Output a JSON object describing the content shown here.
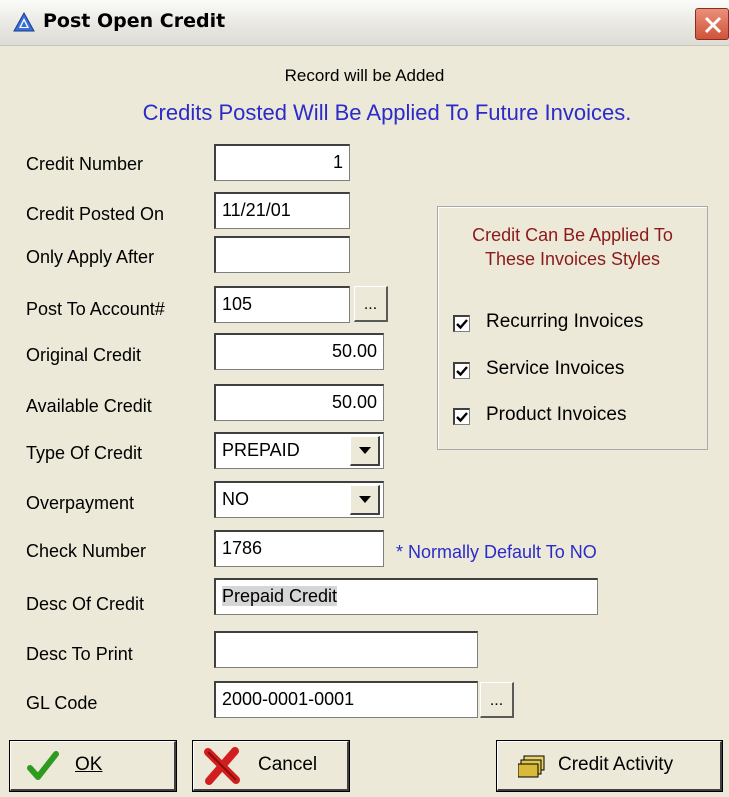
{
  "window": {
    "title": "Post Open Credit",
    "icon": "triangle-app-icon",
    "close_icon": "close-x-icon"
  },
  "status_text": "Record will be Added",
  "banner_text": "Credits Posted Will Be Applied To Future Invoices.",
  "form": {
    "credit_number": {
      "label": "Credit Number",
      "value": "1"
    },
    "credit_posted_on": {
      "label": "Credit Posted On",
      "value": "11/21/01"
    },
    "only_apply_after": {
      "label": "Only Apply After",
      "value": ""
    },
    "post_to_account": {
      "label": "Post To Account#",
      "value": "105",
      "browse_label": "..."
    },
    "original_credit": {
      "label": "Original Credit",
      "value": "50.00"
    },
    "available_credit": {
      "label": "Available Credit",
      "value": "50.00"
    },
    "type_of_credit": {
      "label": "Type Of Credit",
      "value": "PREPAID"
    },
    "overpayment": {
      "label": "Overpayment",
      "value": "NO",
      "hint": "* Normally Default To NO"
    },
    "check_number": {
      "label": "Check Number",
      "value": "1786"
    },
    "desc_of_credit": {
      "label": "Desc Of Credit",
      "value": "Prepaid Credit"
    },
    "desc_to_print": {
      "label": "Desc To Print",
      "value": ""
    },
    "gl_code": {
      "label": "GL Code",
      "value": "2000-0001-0001",
      "browse_label": "..."
    }
  },
  "invoice_styles": {
    "title_line1": "Credit Can Be Applied To",
    "title_line2": "These Invoices Styles",
    "options": [
      {
        "label": "Recurring Invoices",
        "checked": true
      },
      {
        "label": "Service Invoices",
        "checked": true
      },
      {
        "label": "Product Invoices",
        "checked": true
      }
    ]
  },
  "buttons": {
    "ok": {
      "label": "OK",
      "icon": "green-check-icon"
    },
    "cancel": {
      "label": "Cancel",
      "icon": "red-x-icon"
    },
    "credit_activity": {
      "label": "Credit Activity",
      "icon": "folders-icon"
    }
  },
  "colors": {
    "dialog_bg": "#ECE9D8",
    "banner_blue": "#2B2BC9",
    "group_title_red": "#8B1A1A"
  }
}
